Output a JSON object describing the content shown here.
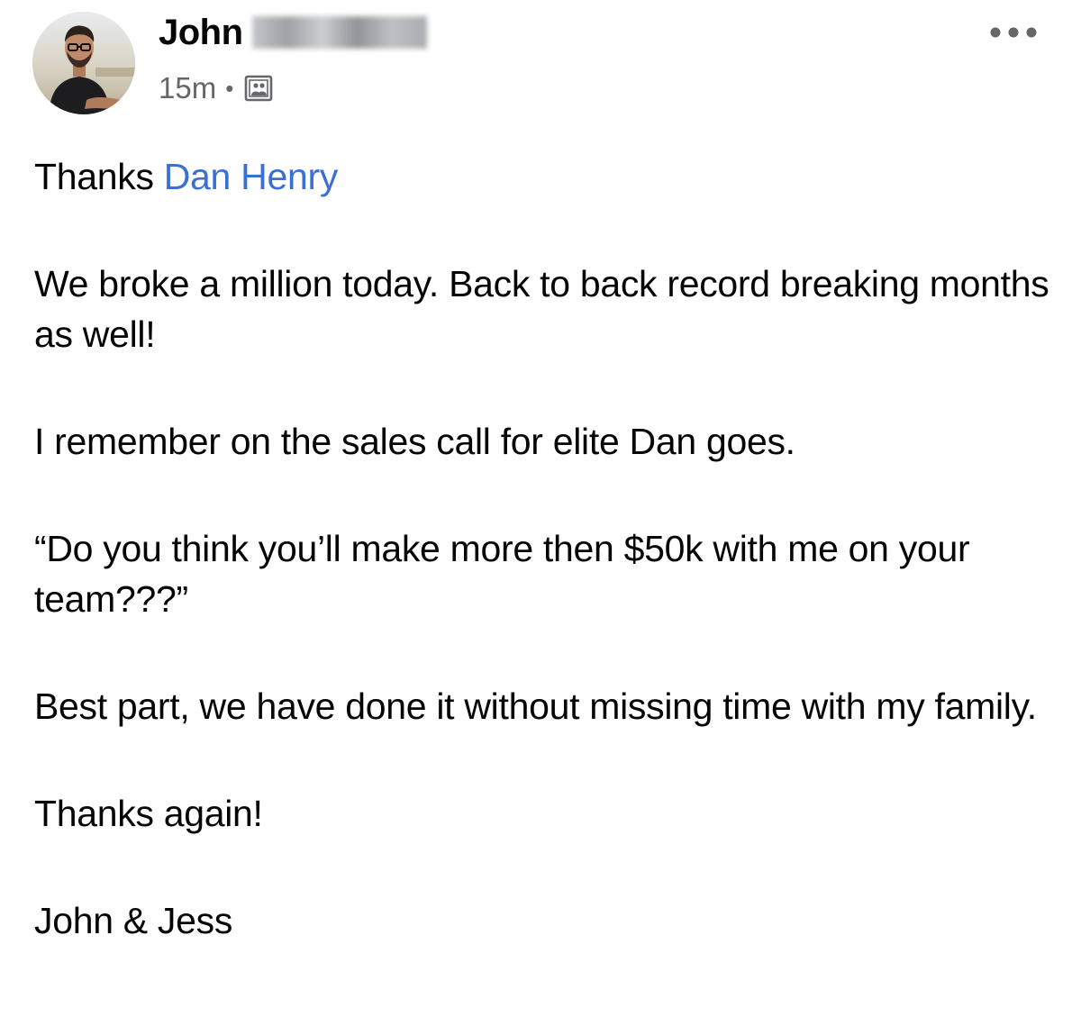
{
  "post": {
    "author": {
      "first_name": "John",
      "last_name_redacted": true
    },
    "time": "15m",
    "separator": "•",
    "audience_icon": "group-audience-icon",
    "more_icon": "more-options-icon",
    "body": {
      "line1_prefix": "Thanks ",
      "mention": "Dan Henry",
      "paragraph2": "We broke a million today. Back to back record breaking months as well!",
      "paragraph3": "I remember on the sales call for elite Dan goes.",
      "paragraph4": "“Do you think you’ll make more then $50k with me on your team???”",
      "paragraph5": "Best part, we have done it without missing time with my family.",
      "paragraph6": "Thanks again!",
      "signature": "John & Jess"
    }
  },
  "colors": {
    "text": "#050505",
    "meta": "#65676b",
    "mention": "#3a6fd8"
  }
}
